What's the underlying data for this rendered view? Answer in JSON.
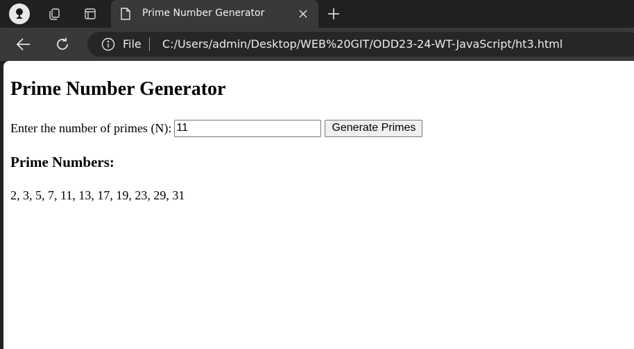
{
  "browser": {
    "tab": {
      "title": "Prime Number Generator"
    },
    "address": {
      "scheme_label": "File",
      "url": "C:/Users/admin/Desktop/WEB%20GIT/ODD23-24-WT-JavaScript/ht3.html"
    },
    "icons": {
      "profile": "profile-avatar-icon",
      "workspaces": "workspaces-icon",
      "tab_actions": "tab-actions-icon",
      "favicon": "document-icon",
      "close": "close-icon",
      "new_tab": "plus-icon",
      "back": "back-arrow-icon",
      "refresh": "refresh-icon",
      "info": "info-icon"
    }
  },
  "page": {
    "heading": "Prime Number Generator",
    "form": {
      "label": "Enter the number of primes (N):",
      "input_value": "11",
      "button_label": "Generate Primes"
    },
    "results": {
      "heading": "Prime Numbers:",
      "text": "2, 3, 5, 7, 11, 13, 17, 19, 23, 29, 31"
    }
  }
}
